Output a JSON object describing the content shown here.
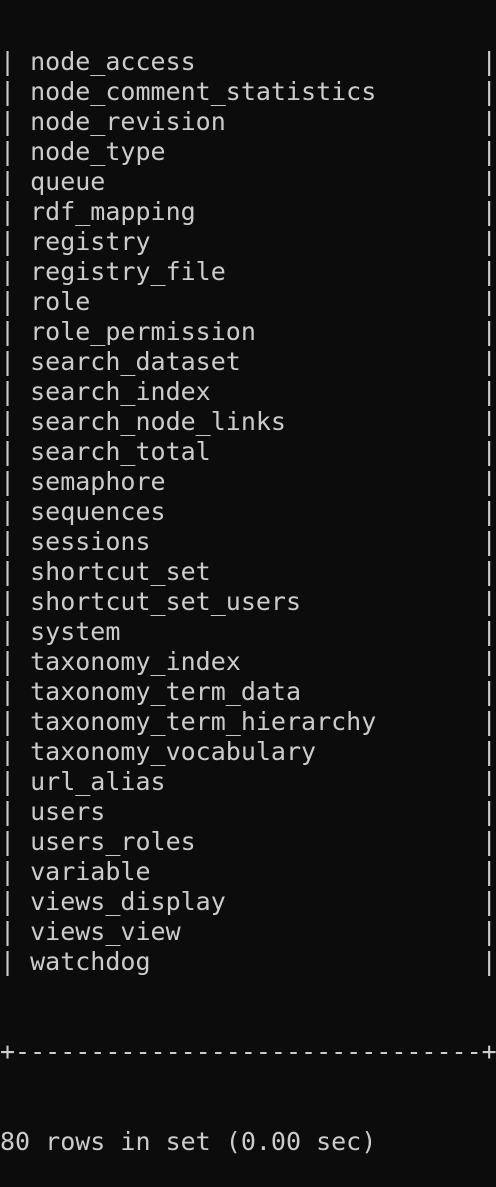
{
  "terminal": {
    "table_rows": [
      "node_access",
      "node_comment_statistics",
      "node_revision",
      "node_type",
      "queue",
      "rdf_mapping",
      "registry",
      "registry_file",
      "role",
      "role_permission",
      "search_dataset",
      "search_index",
      "search_node_links",
      "search_total",
      "semaphore",
      "sequences",
      "sessions",
      "shortcut_set",
      "shortcut_set_users",
      "system",
      "taxonomy_index",
      "taxonomy_term_data",
      "taxonomy_term_hierarchy",
      "taxonomy_vocabulary",
      "url_alias",
      "users",
      "users_roles",
      "variable",
      "views_display",
      "views_view",
      "watchdog"
    ],
    "border_line": "+-------------------------------+",
    "result_summary": "80 rows in set (0.00 sec)"
  }
}
